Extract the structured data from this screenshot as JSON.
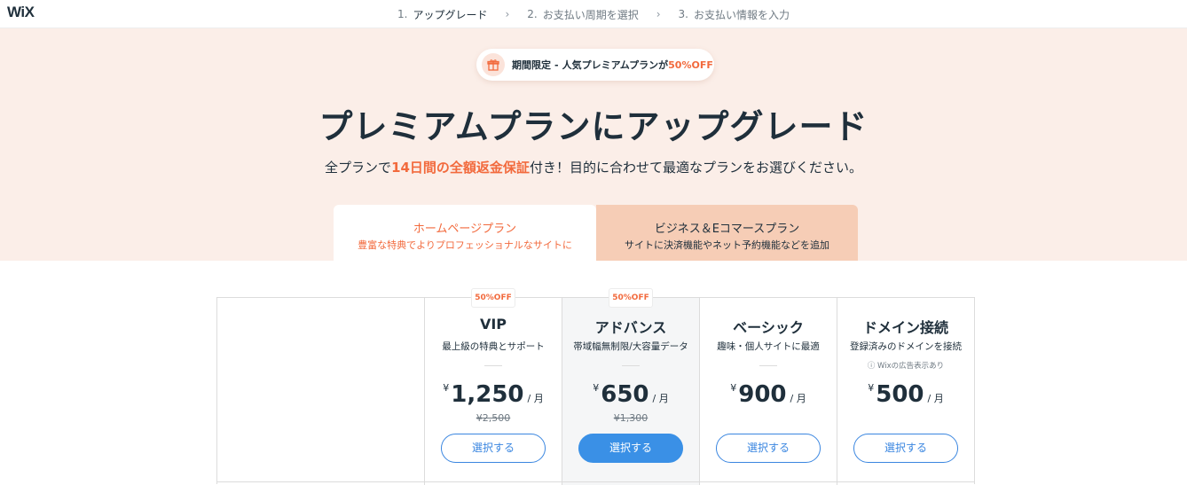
{
  "app": {
    "logo": "WiX"
  },
  "steps": [
    {
      "num": "1.",
      "label": "アップグレード"
    },
    {
      "num": "2.",
      "label": "お支払い周期を選択"
    },
    {
      "num": "3.",
      "label": "お支払い情報を入力"
    }
  ],
  "promo": {
    "text1": "期間限定",
    "sep": "-",
    "text2": "人気プレミアムプランが",
    "off": "50%OFF"
  },
  "hero": {
    "title": "プレミアムプランにアップグレード",
    "subtitle_pre": "全プランで",
    "subtitle_hl": "14日間の全額返金保証",
    "subtitle_post": "付き！目的に合わせて最適なプランをお選びください。"
  },
  "tabs": [
    {
      "title": "ホームページプラン",
      "desc": "豊富な特典でよりプロフェッショナルなサイトに"
    },
    {
      "title": "ビジネス＆Eコマースプラン",
      "desc": "サイトに決済機能やネット予約機能などを追加"
    }
  ],
  "plans": [
    {
      "badge": "50%OFF",
      "name": "VIP",
      "desc": "最上級の特典とサポート",
      "currency": "¥",
      "price": "1,250",
      "per": "/ 月",
      "orig": "¥2,500",
      "button": "選択する"
    },
    {
      "badge": "50%OFF",
      "name": "アドバンス",
      "desc": "帯域幅無制限/大容量データ",
      "currency": "¥",
      "price": "650",
      "per": "/ 月",
      "orig": "¥1,300",
      "button": "選択する"
    },
    {
      "name": "ベーシック",
      "desc": "趣味・個人サイトに最適",
      "currency": "¥",
      "price": "900",
      "per": "/ 月",
      "button": "選択する"
    },
    {
      "name": "ドメイン接続",
      "desc": "登録済みのドメインを接続",
      "note": "ⓘ Wixの広告表示あり",
      "currency": "¥",
      "price": "500",
      "per": "/ 月",
      "button": "選択する"
    }
  ],
  "colors": {
    "accent": "#f26a3d",
    "blue": "#3a90e6",
    "hero_bg": "#fbeee8",
    "tab_inactive": "#f6cdb6"
  }
}
